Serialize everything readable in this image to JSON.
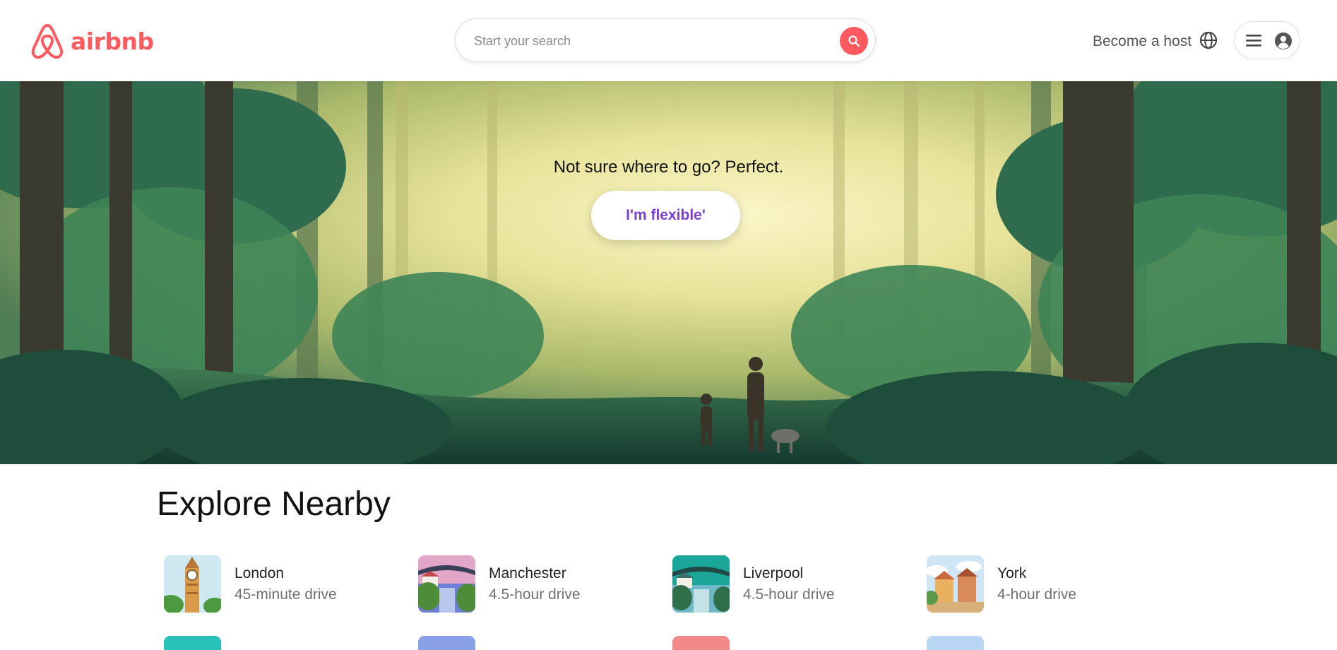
{
  "header": {
    "logo_text": "airbnb",
    "search_placeholder": "Start your search",
    "become_host": "Become a host",
    "brand_color": "#FF5A5F"
  },
  "hero": {
    "tagline": "Not sure where to go? Perfect.",
    "button_label": "I'm flexible'",
    "button_color": "#7c3fd6"
  },
  "explore": {
    "title": "Explore Nearby",
    "places": [
      {
        "name": "London",
        "distance": "45-minute drive",
        "icon": "big-ben-thumb"
      },
      {
        "name": "Manchester",
        "distance": "4.5-hour drive",
        "icon": "bridge-thumb"
      },
      {
        "name": "Liverpool",
        "distance": "4.5-hour drive",
        "icon": "bridge-thumb"
      },
      {
        "name": "York",
        "distance": "4-hour drive",
        "icon": "town-thumb"
      }
    ]
  }
}
